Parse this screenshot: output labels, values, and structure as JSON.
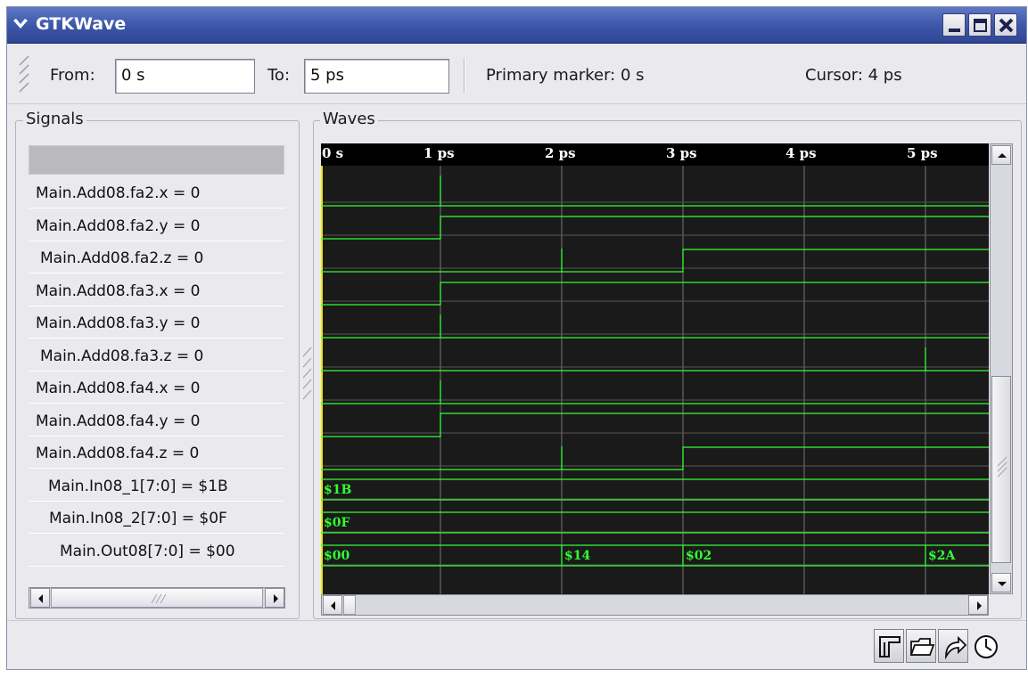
{
  "window": {
    "title": "GTKWave"
  },
  "toolbar": {
    "from_label": "From:",
    "from_value": "0 s",
    "to_label": "To:",
    "to_value": "5 ps",
    "primary_marker": "Primary marker:  0 s",
    "cursor": "Cursor:  4 ps"
  },
  "signals_panel": {
    "label": "Signals",
    "rows": [
      "Main.Add08.fa2.x = 0",
      "Main.Add08.fa2.y = 0",
      "Main.Add08.fa2.z = 0",
      "Main.Add08.fa3.x = 0",
      "Main.Add08.fa3.y = 0",
      "Main.Add08.fa3.z = 0",
      "Main.Add08.fa4.x = 0",
      "Main.Add08.fa4.y = 0",
      "Main.Add08.fa4.z = 0",
      "Main.In08_1[7:0] = $1B",
      "Main.In08_2[7:0] = $0F",
      "Main.Out08[7:0] = $00"
    ]
  },
  "waves_panel": {
    "label": "Waves",
    "time_labels": [
      "0 s",
      "1 ps",
      "2 ps",
      "3 ps",
      "4 ps",
      "5 ps"
    ],
    "bus_values": {
      "in08_1": [
        "$1B"
      ],
      "in08_2": [
        "$0F"
      ],
      "out08": [
        "$00",
        "$14",
        "$02",
        "$2A"
      ]
    },
    "wave_color": "#33ff33",
    "background_color": "#1a1a1a"
  },
  "bottom_toolbar": {
    "icons": [
      "toggle-view-icon",
      "open-folder-icon",
      "reload-icon",
      "clock-icon"
    ]
  }
}
